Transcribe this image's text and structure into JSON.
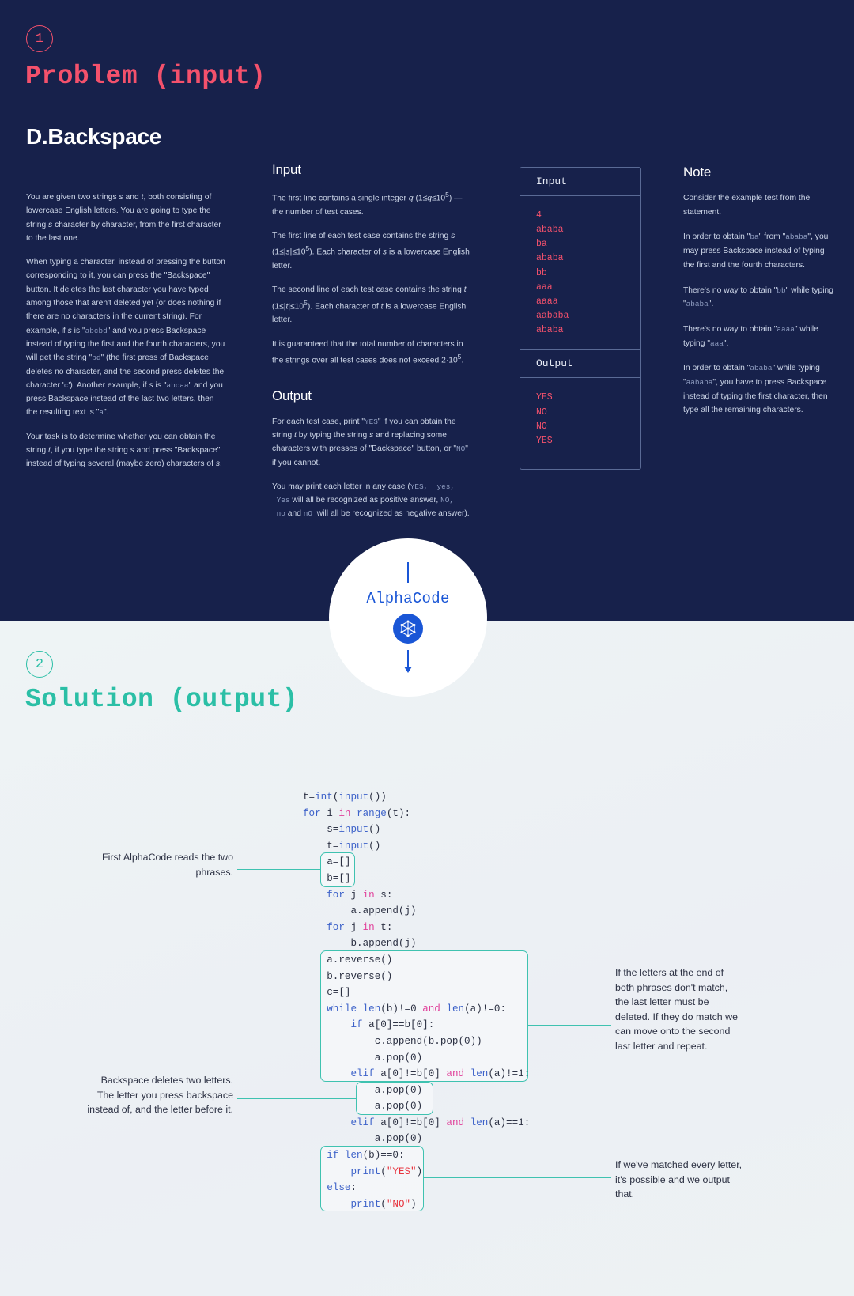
{
  "sections": {
    "one": {
      "badge": "1",
      "title": "Problem (input)"
    },
    "two": {
      "badge": "2",
      "title": "Solution (output)"
    }
  },
  "problem": {
    "name": "D.Backspace",
    "statement": [
      "You are given two strings s and t, both consisting of lowercase English letters. You are going to type the string s character by character, from the first character to the last one.",
      "When typing a character, instead of pressing the button corresponding to it, you can press the \"Backspace\" button. It deletes the last character you have typed among those that aren't deleted yet (or does nothing if there are no characters in the current string). For example, if s is \"abcbd\" and you press Backspace instead of typing the first and the fourth characters, you will get the string \"bd\" (the first press of Backspace deletes no character, and the second press deletes the character 'c'). Another example, if s is \"abcaa\" and you press Backspace instead of the last two letters, then the resulting text is \"a\".",
      "Your task is to determine whether you can obtain the string t, if you type the string s and press \"Backspace\" instead of typing several (maybe zero) characters of s."
    ],
    "input_heading": "Input",
    "input_paras": [
      "The first line contains a single integer q (1≤q≤10⁵) — the number of test cases.",
      "The first line of each test case contains the string s (1≤|s|≤10⁵). Each character of s is a lowercase English letter.",
      "The second line of each test case contains the string t (1≤|t|≤10⁵). Each character of t is a lowercase English letter.",
      "It is guaranteed that the total number of characters in the strings over all test cases does not exceed 2·10⁵."
    ],
    "output_heading": "Output",
    "output_paras": [
      "For each test case, print \"YES\" if you can obtain the string t by typing the string s and replacing some characters with presses of \"Backspace\" button, or \"NO\" if you cannot.",
      "You may print each letter in any case (YES, yes, Yes will all be recognized as positive answer, NO, no and nO will all be recognized as negative answer)."
    ],
    "note_heading": "Note",
    "note_paras": [
      "Consider the example test from the statement.",
      "In order to obtain \"ba\" from \"ababa\", you may press Backspace instead of typing the first and the fourth characters.",
      "There's no way to obtain \"bb\" while typing \"ababa\".",
      "There's no way to obtain \"aaaa\" while typing \"aaa\".",
      "In order to obtain \"ababa\" while typing \"aababa\", you have to press Backspace instead of typing the first character, then type all the remaining characters."
    ]
  },
  "example": {
    "input_label": "Input",
    "input_lines": [
      "4",
      "ababa",
      "ba",
      "ababa",
      "bb",
      "aaa",
      "aaaa",
      "aababa",
      "ababa"
    ],
    "output_label": "Output",
    "output_lines": [
      "YES",
      "NO",
      "NO",
      "YES"
    ]
  },
  "alphacode": {
    "word": "AlphaCode",
    "logo_name": "alphacode-cube-logo"
  },
  "solution": {
    "code_lines": [
      "t=int(input())",
      "for i in range(t):",
      "    s=input()",
      "    t=input()",
      "    a=[]",
      "    b=[]",
      "    for j in s:",
      "        a.append(j)",
      "    for j in t:",
      "        b.append(j)",
      "    a.reverse()",
      "    b.reverse()",
      "    c=[]",
      "    while len(b)!=0 and len(a)!=0:",
      "        if a[0]==b[0]:",
      "            c.append(b.pop(0))",
      "            a.pop(0)",
      "        elif a[0]!=b[0] and len(a)!=1:",
      "            a.pop(0)",
      "            a.pop(0)",
      "        elif a[0]!=b[0] and len(a)==1:",
      "            a.pop(0)",
      "    if len(b)==0:",
      "        print(\"YES\")",
      "    else:",
      "        print(\"NO\")"
    ],
    "annotations": [
      "First AlphaCode reads the two phrases.",
      "If the letters at the end of both phrases don't match, the last letter must be deleted. If they do match we can move onto the second last letter and repeat.",
      "Backspace deletes two letters. The letter you press backspace instead of, and the letter before it.",
      "If we've matched every letter, it's possible and we output that."
    ]
  },
  "colors": {
    "dark_bg": "#17214b",
    "light_bg": "#eef3f4",
    "pink": "#f4516c",
    "teal": "#2bbfa6",
    "blue": "#1a56d6",
    "keyword_blue": "#3d62c9",
    "keyword_pink": "#e0409a",
    "string_red": "#e8343f"
  }
}
